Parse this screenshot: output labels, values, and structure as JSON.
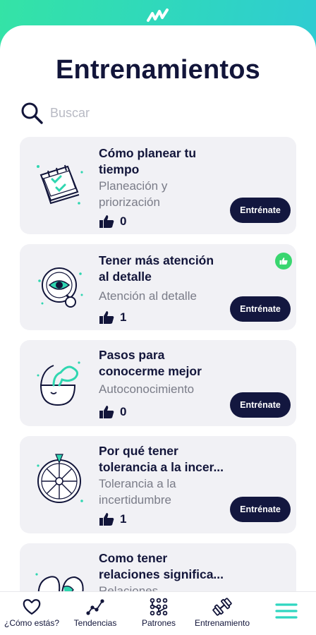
{
  "colors": {
    "accent": "#34e3a6",
    "dark": "#13173f",
    "card_bg": "#f1f1f5",
    "done_green": "#39d66f"
  },
  "header": {
    "logo_icon": "wave-logo-icon",
    "title": "Entrenamientos"
  },
  "search": {
    "placeholder": "Buscar",
    "icon": "search-icon"
  },
  "trainings": [
    {
      "title": "Cómo planear tu\ntiempo",
      "subtitle": "Planeación y\npriorización",
      "likes": "0",
      "button": "Entrénate",
      "icon": "calendar-icon",
      "completed": false
    },
    {
      "title": "Tener más atención\nal detalle",
      "subtitle": "Atención al detalle",
      "likes": "1",
      "button": "Entrénate",
      "icon": "magnifier-eye-icon",
      "completed": true
    },
    {
      "title": "Pasos para\nconocerme mejor",
      "subtitle": "Autoconocimiento",
      "likes": "0",
      "button": "Entrénate",
      "icon": "open-head-icon",
      "completed": false
    },
    {
      "title": "Por qué tener\ntolerancia a la incer...",
      "subtitle": "Tolerancia a la\nincertidumbre",
      "likes": "1",
      "button": "Entrénate",
      "icon": "wheel-icon",
      "completed": false
    },
    {
      "title": "Como tener\nrelaciones significa...",
      "subtitle": "Relaciones",
      "icon": "hands-icon",
      "completed": false
    }
  ],
  "tabs": [
    {
      "label": "¿Cómo estás?",
      "icon": "heart-icon"
    },
    {
      "label": "Tendencias",
      "icon": "trend-line-icon"
    },
    {
      "label": "Patrones",
      "icon": "pattern-grid-icon"
    },
    {
      "label": "Entrenamiento",
      "icon": "dumbbell-icon"
    },
    {
      "label": "",
      "icon": "menu-icon"
    }
  ]
}
